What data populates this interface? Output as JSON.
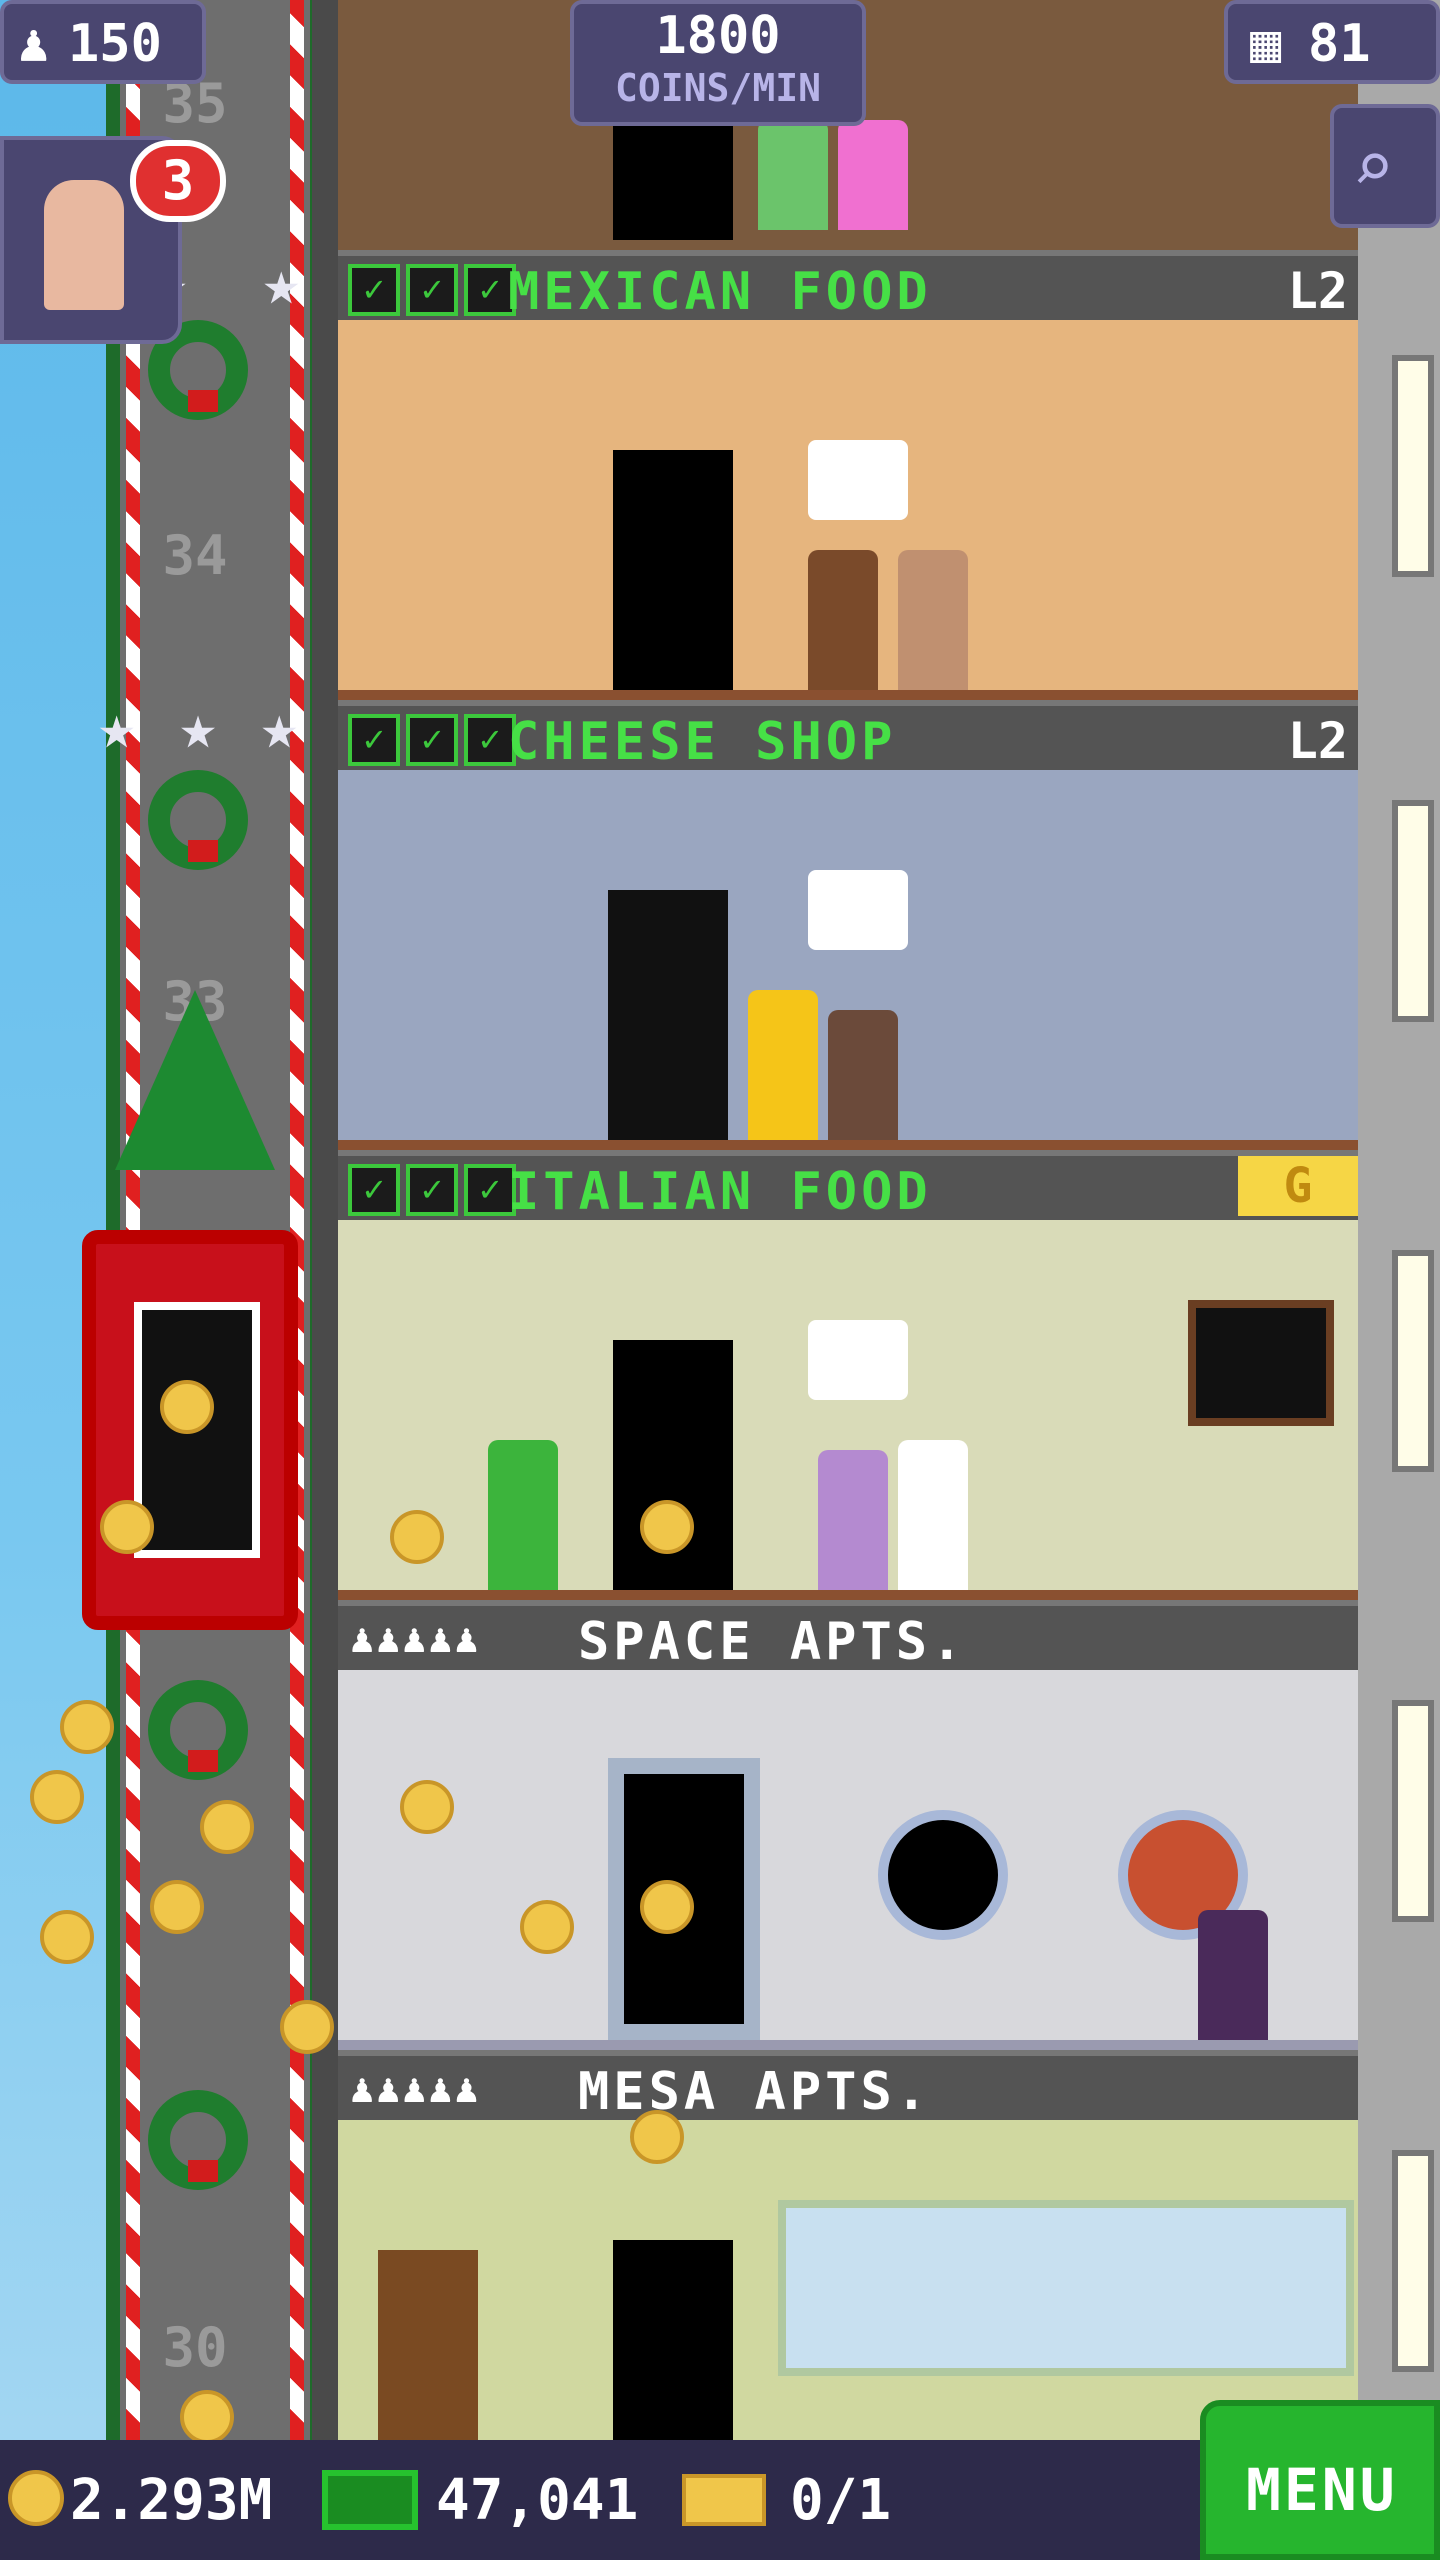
{
  "hud": {
    "population": "150",
    "coins_per_min_value": "1800",
    "coins_per_min_label": "COINS/MIN",
    "floors": "81",
    "notification_count": "3"
  },
  "elevator": {
    "floor_labels": [
      "35",
      "34",
      "33",
      "30"
    ]
  },
  "floors": [
    {
      "name": "MEXICAN FOOD",
      "level": "L2",
      "checks": 3
    },
    {
      "name": "CHEESE SHOP",
      "level": "L2",
      "checks": 3
    },
    {
      "name": "ITALIAN FOOD",
      "level": "G",
      "checks": 3
    },
    {
      "name": "SPACE APTS.",
      "level": "",
      "residents": 5
    },
    {
      "name": "MESA APTS.",
      "level": "",
      "residents": 5
    }
  ],
  "bottom_bar": {
    "coins": "2.293M",
    "bux": "47,041",
    "tickets": "0/1",
    "menu_label": "MENU"
  },
  "icons": {
    "population": "person-icon",
    "floors": "building-icon",
    "search": "magnifier-icon",
    "coin": "coin-icon",
    "bux": "cash-icon",
    "ticket": "ticket-icon"
  },
  "colors": {
    "hud_bg": "#4a4670",
    "menu_green": "#26b52e",
    "check_green": "#3cc83c",
    "gold": "#f0c64a"
  }
}
